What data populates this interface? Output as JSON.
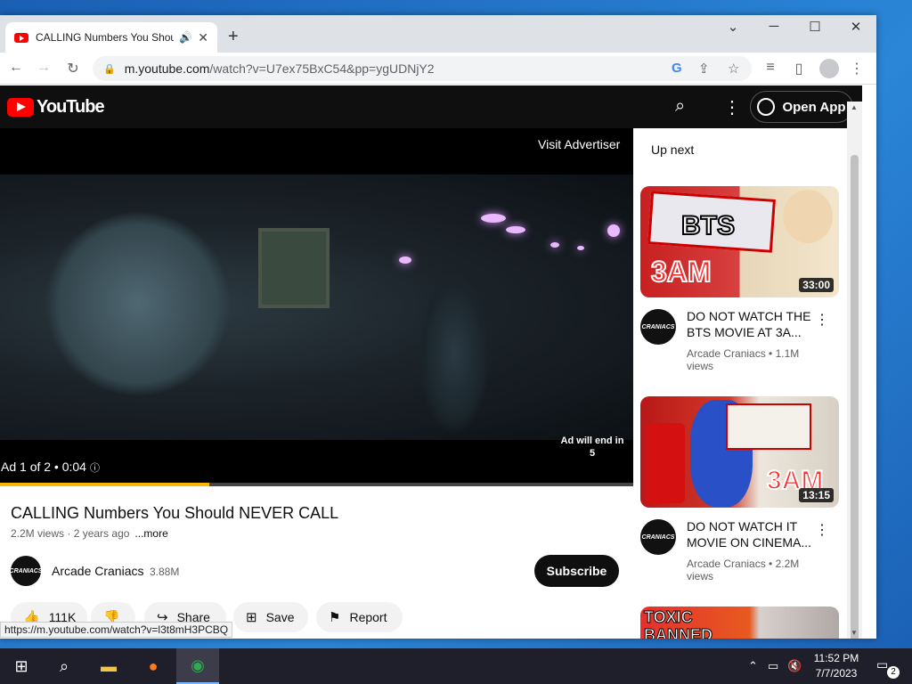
{
  "browser": {
    "tab_title": "CALLING Numbers You Shou",
    "tab_audio": "🔊",
    "tab_close": "✕",
    "new_tab": "+",
    "url_host": "m.youtube.com",
    "url_path": "/watch?v=U7ex75BxC54&pp=ygUDNjY2",
    "status_url": "https://m.youtube.com/watch?v=l3t8mH3PCBQ",
    "controls": {
      "tablist": "⌄",
      "minimize": "─",
      "maximize": "☐",
      "close": "✕"
    }
  },
  "youtube": {
    "logo_text": "YouTube",
    "open_app": "Open App"
  },
  "player": {
    "visit_advertiser": "Visit Advertiser",
    "ad_will_end": "Ad will end in 5",
    "ad_info": "Ad 1 of 2 • 0:04",
    "ad_progress": 0.33
  },
  "video": {
    "title": "CALLING Numbers You Should NEVER CALL",
    "views": "2.2M views",
    "age": "2 years ago",
    "more": "...more",
    "channel": "Arcade Craniacs",
    "channel_avatar": "CRANIACS",
    "subscribers": "3.88M",
    "subscribe": "Subscribe",
    "actions": {
      "likes": "111K",
      "share": "Share",
      "save": "Save",
      "report": "Report"
    }
  },
  "sidebar": {
    "up_next": "Up next",
    "cards": [
      {
        "title": "DO NOT WATCH THE BTS MOVIE AT 3A...",
        "channel": "Arcade Craniacs • 1.1M views",
        "duration": "33:00",
        "thumb_text": "BTS",
        "thumb_text2": "3AM"
      },
      {
        "title": "DO NOT WATCH IT MOVIE ON CINEMA...",
        "channel": "Arcade Craniacs • 2.2M views",
        "duration": "13:15",
        "thumb_text": "3AM"
      },
      {
        "thumb_text": "TOXIC BANNED CANDIES YOU CANNOT EAT"
      }
    ]
  },
  "taskbar": {
    "time": "11:52 PM",
    "date": "7/7/2023",
    "notifications": "2"
  },
  "colors": {
    "youtube_red": "#ff0000",
    "ad_progress": "#f6b800"
  }
}
